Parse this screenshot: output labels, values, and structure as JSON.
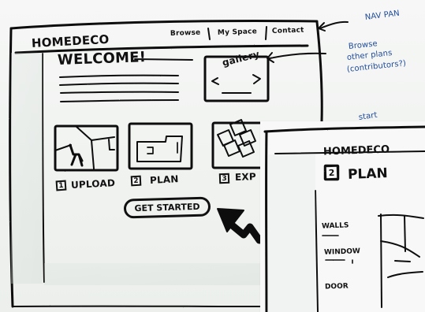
{
  "main_sketch": {
    "brand": "HOMEDECO",
    "nav": {
      "browse": "Browse",
      "my_space": "My Space",
      "contact": "Contact"
    },
    "welcome": "WELCOME!",
    "gallery": "gallery",
    "steps": [
      {
        "number": "1",
        "label": "UPLOAD"
      },
      {
        "number": "2",
        "label": "PLAN"
      },
      {
        "number": "3",
        "label": "EXP"
      }
    ],
    "cta": "GET STARTED"
  },
  "annotations": {
    "nav_pan": "NAV PAN",
    "browse_note_line1": "Browse",
    "browse_note_line2": "other plans",
    "browse_note_line3": "(contributors?)",
    "start": "start"
  },
  "second_sketch": {
    "brand": "HOMEDECO",
    "step_number": "2",
    "step_label": "PLAN",
    "tools": [
      "WALLS",
      "WINDOW",
      "DOOR"
    ]
  }
}
